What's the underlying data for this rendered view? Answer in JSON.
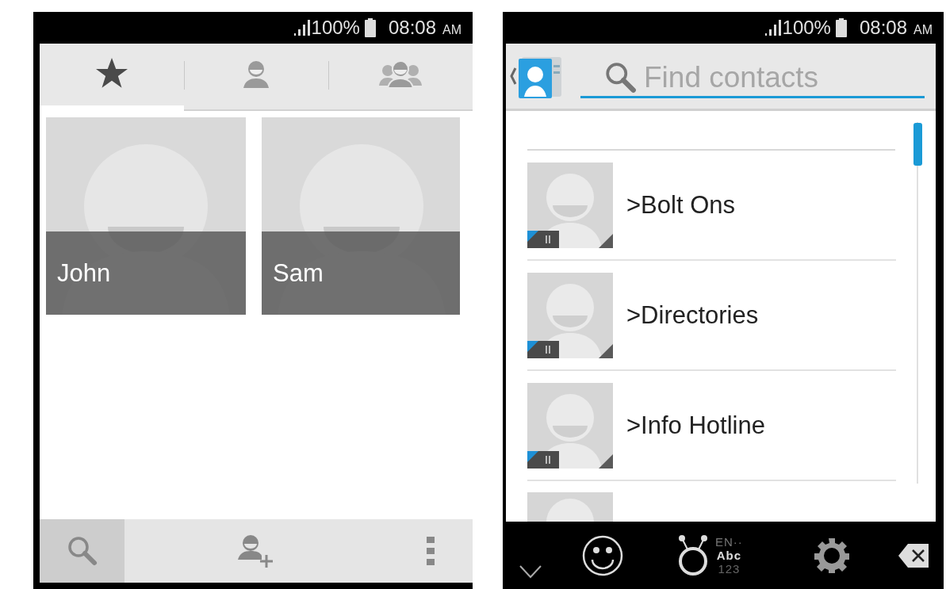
{
  "favorites_screen": {
    "status_bar": {
      "battery": "100%",
      "time": "08:08",
      "meridiem": "AM"
    },
    "tabs": [
      {
        "kind": "star",
        "selected": true
      },
      {
        "kind": "person",
        "selected": false
      },
      {
        "kind": "group",
        "selected": false
      }
    ],
    "tiles": [
      {
        "name": "John"
      },
      {
        "name": "Sam"
      }
    ],
    "action_bar": [
      {
        "kind": "search",
        "selected": true
      },
      {
        "kind": "add-person",
        "selected": false
      },
      {
        "kind": "overflow",
        "selected": false
      }
    ]
  },
  "search_screen": {
    "status_bar": {
      "battery": "100%",
      "time": "08:08",
      "meridiem": "AM"
    },
    "search": {
      "placeholder": "Find contacts"
    },
    "contacts": [
      {
        "name": ">Bolt Ons"
      },
      {
        "name": ">Directories"
      },
      {
        "name": ">Info Hotline"
      }
    ],
    "keyboard": {
      "language": "EN··",
      "mode": "Abc",
      "alt_mode": "123"
    }
  }
}
